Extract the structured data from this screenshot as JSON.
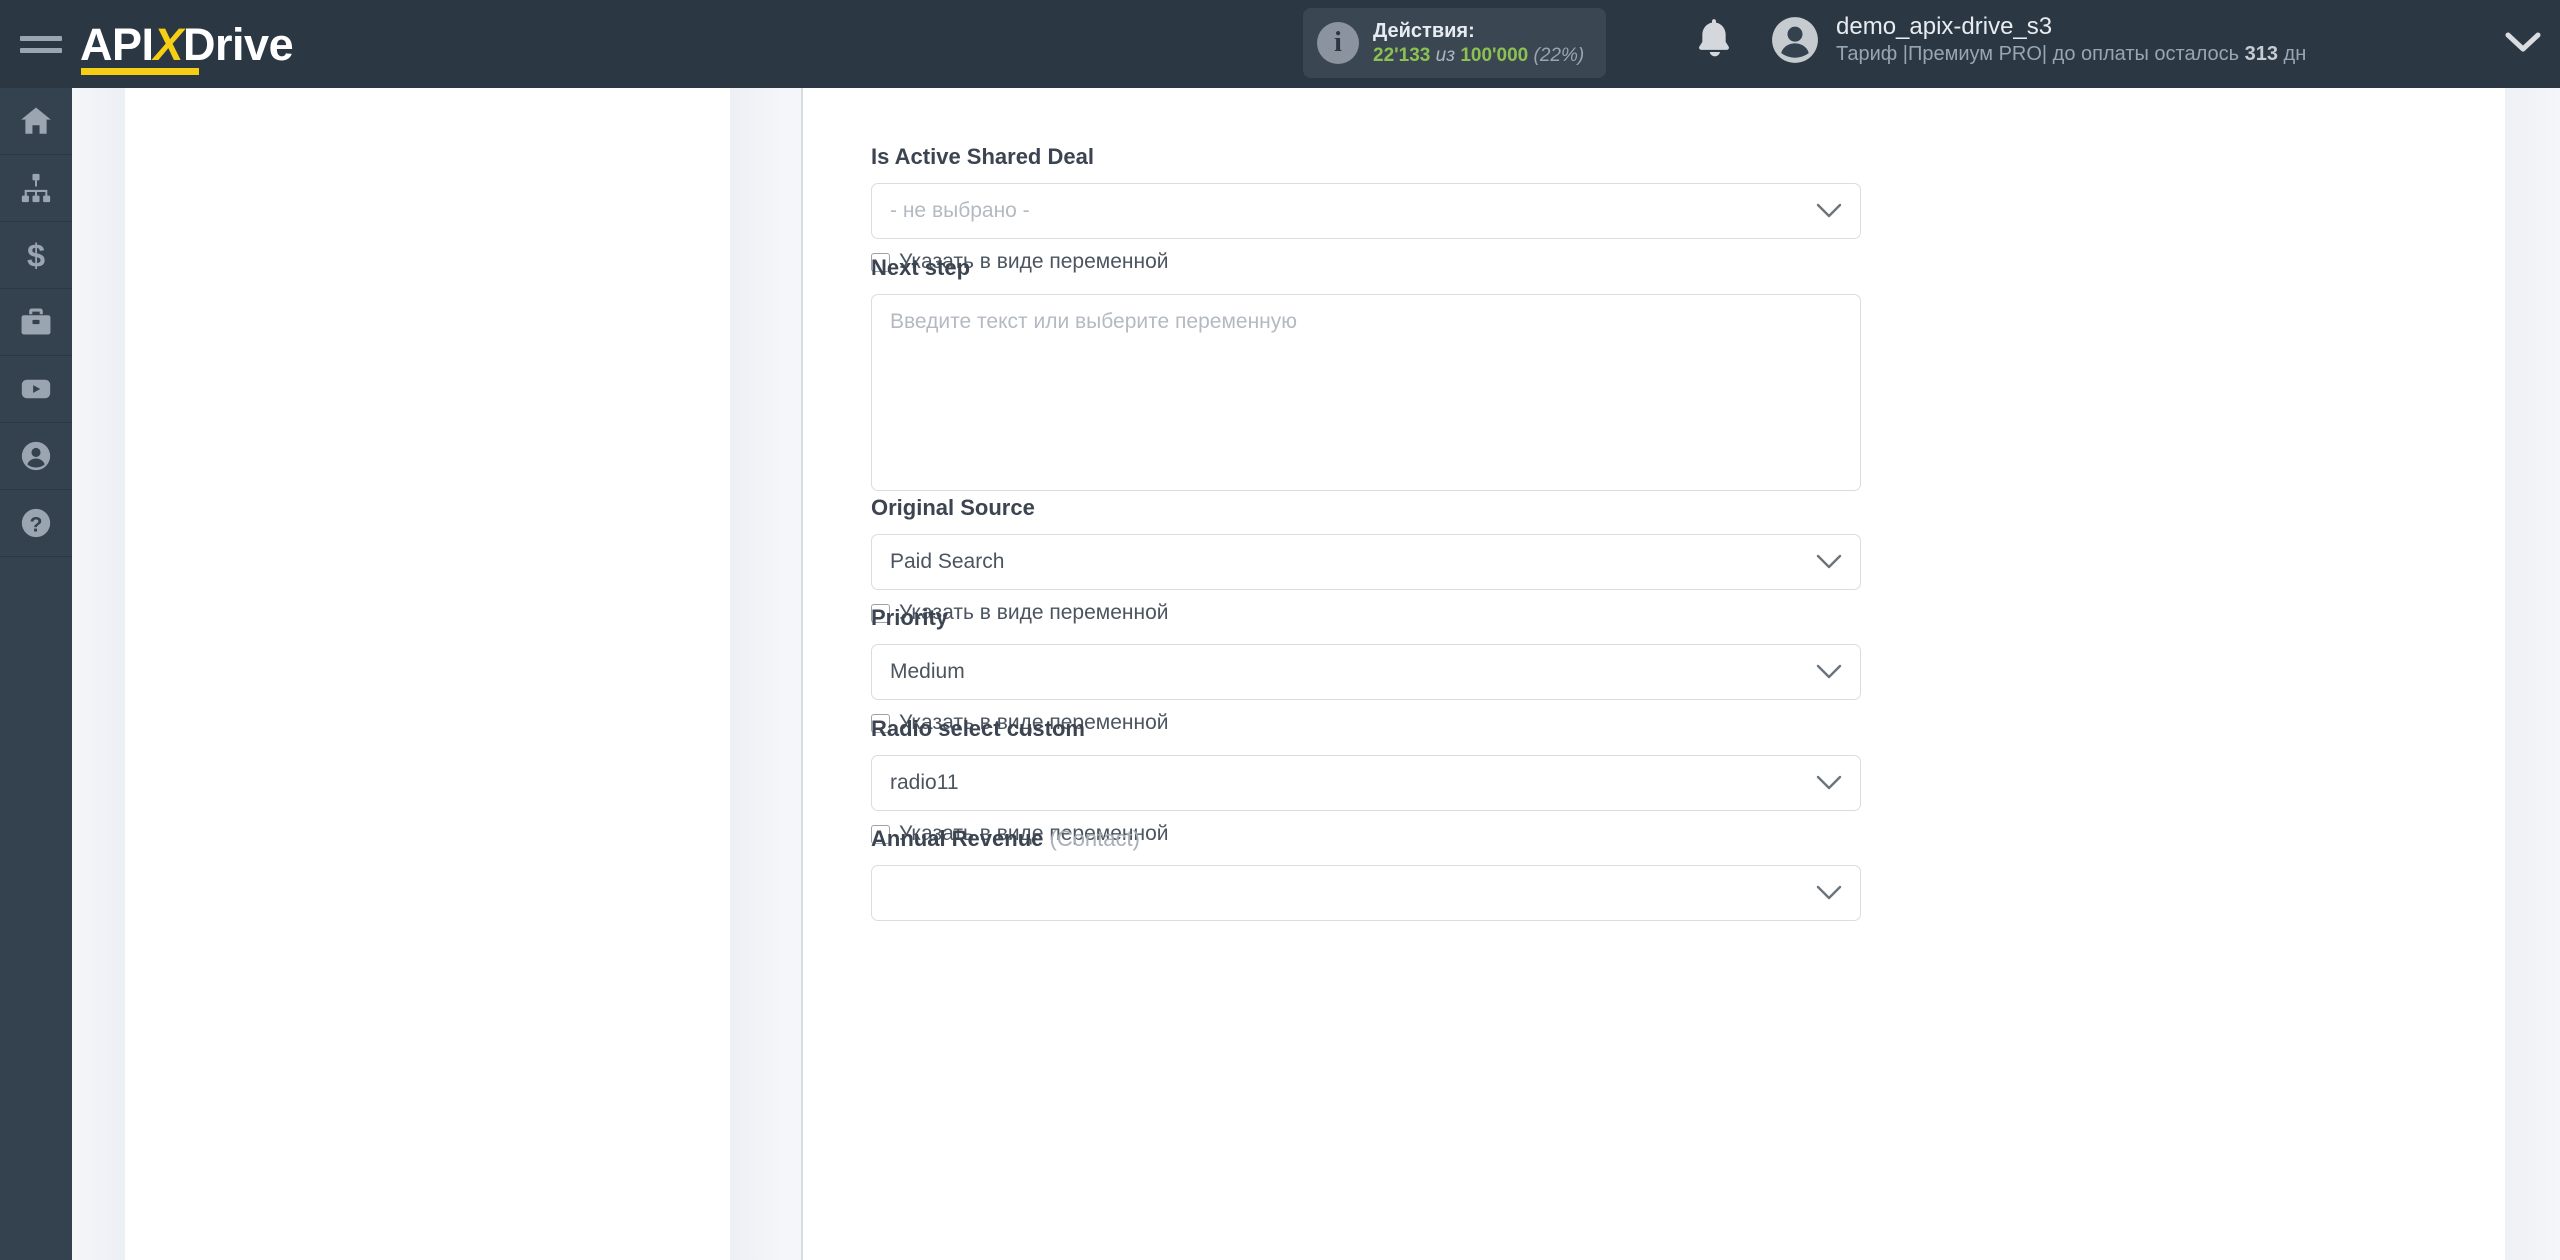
{
  "header": {
    "menu_icon": "hamburger-icon",
    "logo": {
      "part1": "API",
      "x": "X",
      "part2": "Drive"
    },
    "actions": {
      "info_glyph": "i",
      "title": "Действия:",
      "used": "22'133",
      "of": "из",
      "total": "100'000",
      "percent": "(22%)"
    },
    "bell_icon": "bell-icon",
    "user": {
      "avatar_icon": "user-avatar-icon",
      "name": "demo_apix-drive_s3",
      "plan_prefix": "Тариф |Премиум PRO| до оплаты осталось ",
      "days": "313",
      "days_unit": " дн"
    },
    "caret_icon": "chevron-down-icon"
  },
  "sidebar": {
    "items": [
      {
        "name": "home",
        "icon": "home-icon"
      },
      {
        "name": "connections",
        "icon": "sitemap-icon"
      },
      {
        "name": "billing",
        "icon": "dollar-icon"
      },
      {
        "name": "services",
        "icon": "briefcase-icon"
      },
      {
        "name": "video",
        "icon": "youtube-icon"
      },
      {
        "name": "profile",
        "icon": "person-icon"
      },
      {
        "name": "help",
        "icon": "question-circle-icon"
      }
    ]
  },
  "form": {
    "variable_checkbox_label": "Указать в виде переменной",
    "fields": [
      {
        "id": "is-active-shared-deal",
        "label": "Is Active Shared Deal",
        "label_suffix": "",
        "type": "select",
        "value": "- не выбрано -",
        "is_placeholder": true,
        "has_variable_checkbox": true,
        "checkbox_checked": false
      },
      {
        "id": "next-step",
        "label": "Next step",
        "label_suffix": "",
        "type": "textarea",
        "value": "",
        "placeholder": "Введите текст или выберите переменную",
        "has_variable_checkbox": false
      },
      {
        "id": "original-source",
        "label": "Original Source",
        "label_suffix": "",
        "type": "select",
        "value": "Paid Search",
        "is_placeholder": false,
        "has_variable_checkbox": true,
        "checkbox_checked": false
      },
      {
        "id": "priority",
        "label": "Priority",
        "label_suffix": "",
        "type": "select",
        "value": "Medium",
        "is_placeholder": false,
        "has_variable_checkbox": true,
        "checkbox_checked": false
      },
      {
        "id": "radio-select-custom",
        "label": "Radio select custom",
        "label_suffix": "",
        "type": "select",
        "value": "radio11",
        "is_placeholder": false,
        "has_variable_checkbox": true,
        "checkbox_checked": false
      },
      {
        "id": "annual-revenue",
        "label": "Annual Revenue",
        "label_suffix": " (Contact)",
        "type": "select",
        "value": "",
        "is_placeholder": true,
        "has_variable_checkbox": false
      }
    ]
  },
  "colors": {
    "header_bg": "#2b3844",
    "rail_bg": "#34414f",
    "accent_yellow": "#f5cf13",
    "quota_green": "#8cc152",
    "page_bg": "#f4f6f9"
  }
}
